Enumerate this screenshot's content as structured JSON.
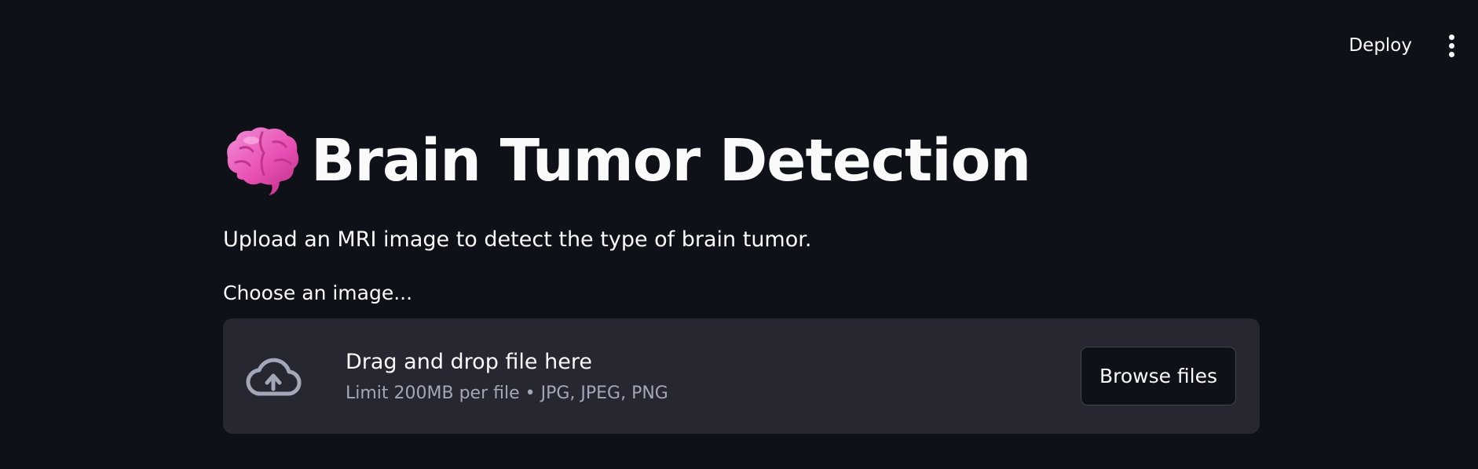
{
  "toolbar": {
    "deploy_label": "Deploy",
    "menu_icon": "more-vertical-icon"
  },
  "header": {
    "icon": "brain-emoji-icon",
    "title": "Brain Tumor Detection"
  },
  "main": {
    "description": "Upload an MRI image to detect the type of brain tumor."
  },
  "uploader": {
    "label": "Choose an image...",
    "icon": "cloud-upload-icon",
    "drop_text": "Drag and drop file here",
    "limit_text": "Limit 200MB per file • JPG, JPEG, PNG",
    "browse_label": "Browse files"
  },
  "colors": {
    "background": "#0e1117",
    "dropzone": "#262730",
    "text": "#fafafa",
    "muted_text": "#a3a8b8",
    "brain": "#f25fb7"
  }
}
